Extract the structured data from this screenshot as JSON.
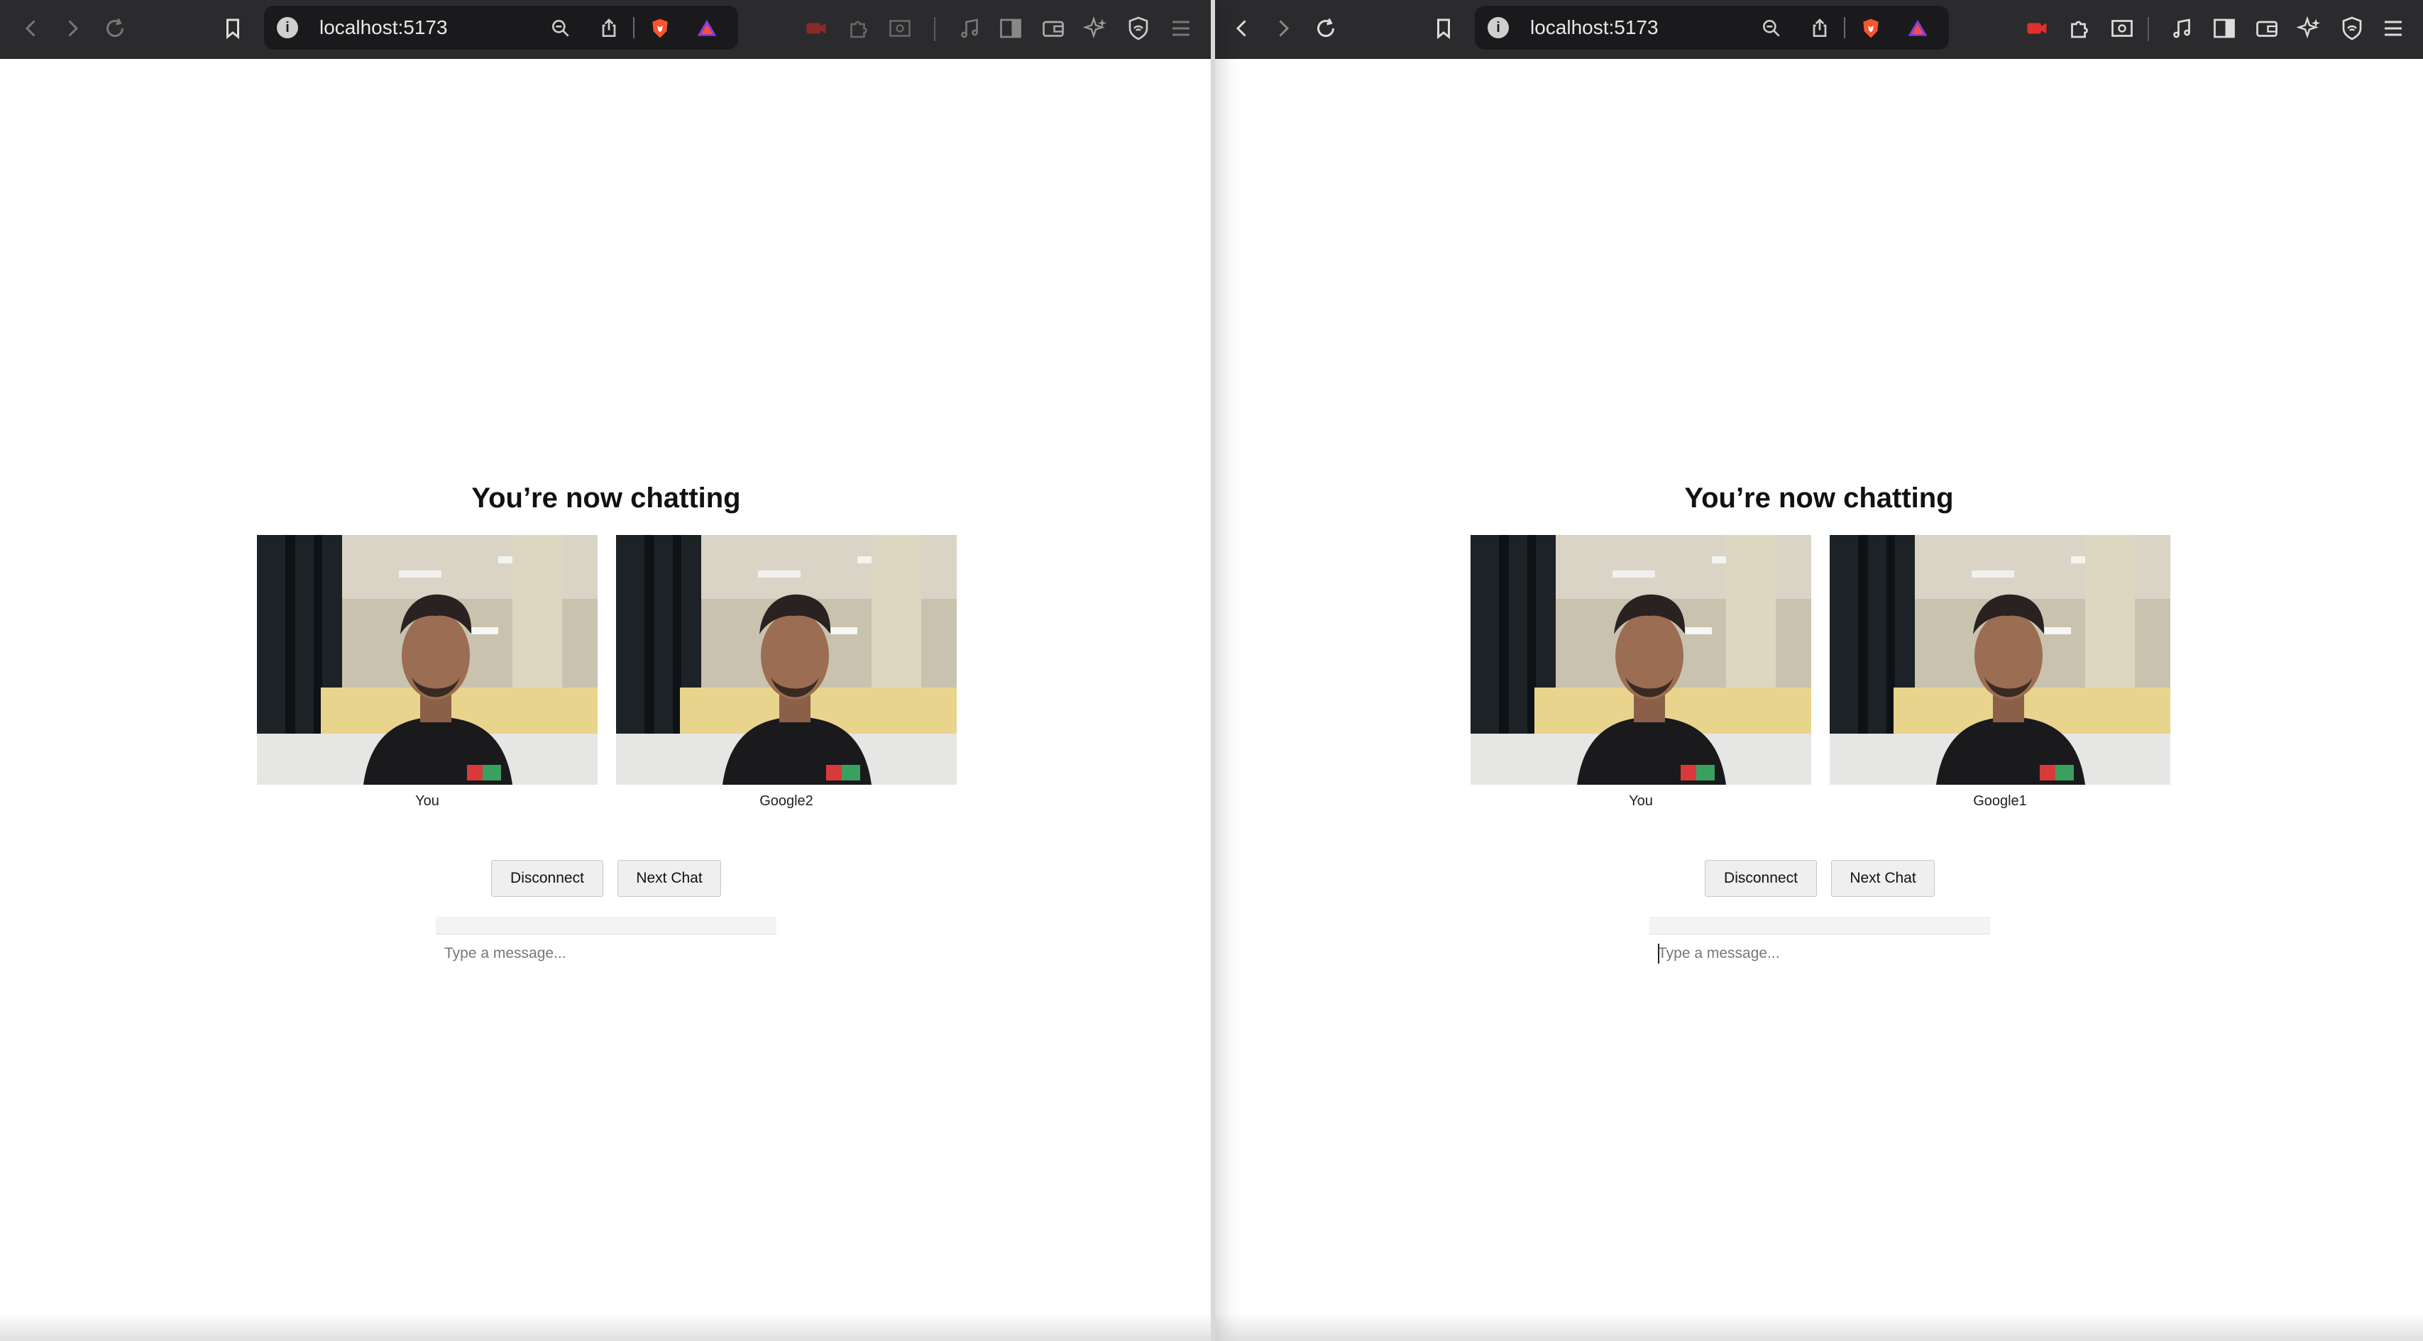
{
  "windows": [
    {
      "url": "localhost:5173",
      "heading": "You’re now chatting",
      "local_video_label": "You",
      "remote_video_label": "Google2",
      "disconnect_label": "Disconnect",
      "next_chat_label": "Next Chat",
      "message_placeholder": "Type a message...",
      "message_value": ""
    },
    {
      "url": "localhost:5173",
      "heading": "You’re now chatting",
      "local_video_label": "You",
      "remote_video_label": "Google1",
      "disconnect_label": "Disconnect",
      "next_chat_label": "Next Chat",
      "message_placeholder": "Type a message...",
      "message_value": ""
    }
  ],
  "colors": {
    "toolbar_bg": "#2b2b2e",
    "url_bar_bg": "#1a1a1c",
    "button_bg": "#efefef",
    "page_bg": "#ffffff",
    "brave_orange": "#fb542b",
    "record_red": "#e0312c"
  },
  "icons": [
    "back-arrow-icon",
    "forward-arrow-icon",
    "reload-icon",
    "bookmark-icon",
    "site-info-icon",
    "zoom-icon",
    "share-icon",
    "brave-shields-icon",
    "brave-rewards-icon",
    "screen-record-icon",
    "extensions-icon",
    "reader-mode-icon",
    "media-icon",
    "sidebar-icon",
    "wallet-icon",
    "leo-ai-icon",
    "vpn-icon",
    "menu-icon"
  ]
}
